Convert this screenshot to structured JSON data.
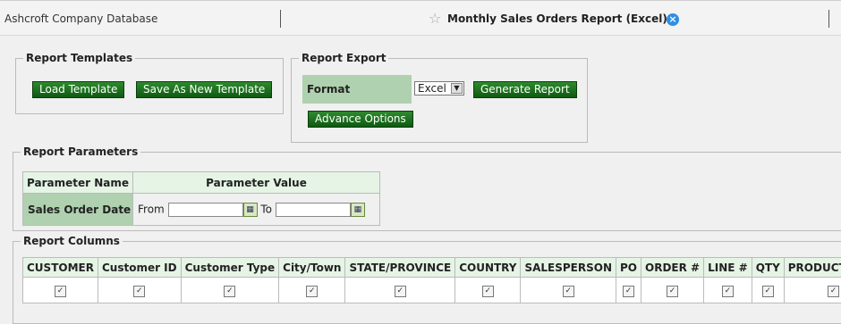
{
  "header": {
    "db_name": "Ashcroft Company Database",
    "report_title": "Monthly Sales Orders Report (Excel)",
    "star_icon": "star-icon",
    "close_icon": "close-icon"
  },
  "templates": {
    "legend": "Report Templates",
    "load_label": "Load Template",
    "save_label": "Save As New Template"
  },
  "export": {
    "legend": "Report Export",
    "format_label": "Format",
    "format_value": "Excel",
    "generate_label": "Generate Report",
    "advance_label": "Advance Options"
  },
  "parameters": {
    "legend": "Report Parameters",
    "col_name": "Parameter Name",
    "col_value": "Parameter Value",
    "row_name": "Sales Order Date",
    "from_label": "From",
    "to_label": "To"
  },
  "columns": {
    "legend": "Report Columns",
    "headers": [
      "CUSTOMER",
      "Customer ID",
      "Customer Type",
      "City/Town",
      "STATE/PROVINCE",
      "COUNTRY",
      "SALESPERSON",
      "PO",
      "ORDER #",
      "LINE #",
      "QTY",
      "PRODUCT FAMI"
    ],
    "checked": [
      true,
      true,
      true,
      true,
      true,
      true,
      true,
      true,
      true,
      true,
      true,
      true
    ]
  },
  "colors": {
    "button_green": "#1a6b1c",
    "label_green": "#afd1af",
    "header_green": "#e5f4e5",
    "close_blue": "#2e8fe6"
  }
}
